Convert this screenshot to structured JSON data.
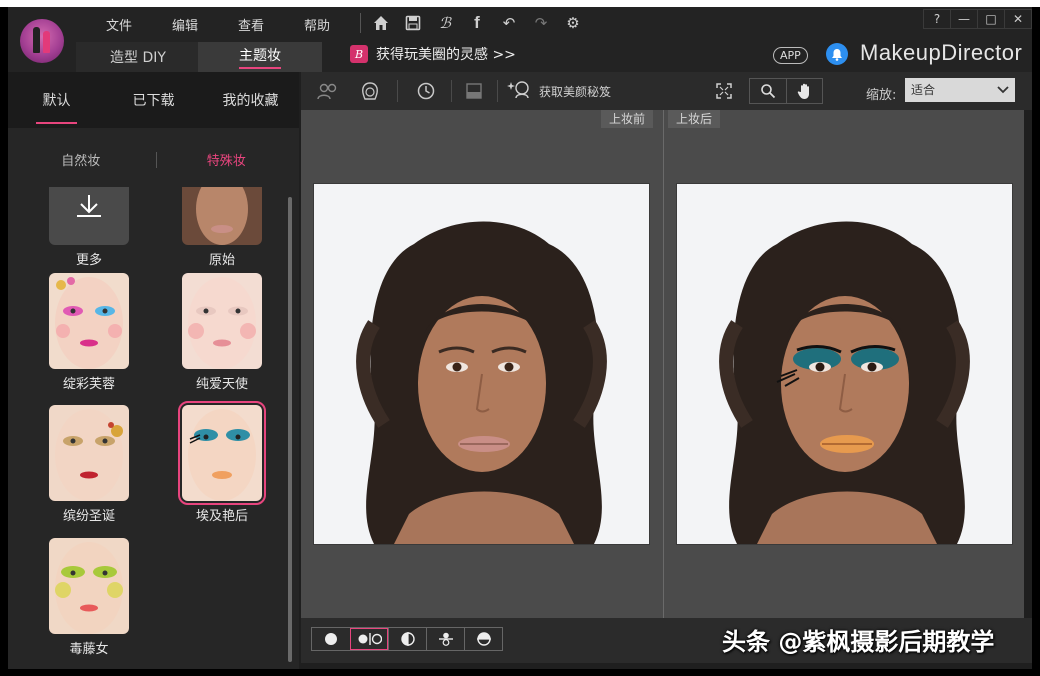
{
  "menu": {
    "items": [
      "文件",
      "编辑",
      "查看",
      "帮助"
    ]
  },
  "toolbar_icons": [
    "home-icon",
    "save-icon",
    "brand-b-icon",
    "facebook-icon",
    "undo-icon",
    "redo-icon",
    "settings-icon"
  ],
  "window_buttons": [
    "?",
    "—",
    "□",
    "✕"
  ],
  "mode_tabs": [
    {
      "label": "造型 DIY",
      "active": false
    },
    {
      "label": "主题妆",
      "active": true
    }
  ],
  "promo": {
    "badge": "B",
    "text": "获得玩美圈的灵感 >>"
  },
  "app_pill": "APP",
  "brand": "MakeupDirector",
  "left": {
    "subtabs": [
      {
        "label": "默认",
        "active": true
      },
      {
        "label": "已下载",
        "active": false
      },
      {
        "label": "我的收藏",
        "active": false
      }
    ],
    "categories": [
      {
        "label": "自然妆",
        "active": false
      },
      {
        "label": "特殊妆",
        "active": true
      }
    ],
    "items": [
      {
        "label": "更多",
        "kind": "more"
      },
      {
        "label": "原始",
        "kind": "face"
      },
      {
        "label": "绽彩芙蓉",
        "kind": "face"
      },
      {
        "label": "纯爱天使",
        "kind": "face"
      },
      {
        "label": "缤纷圣诞",
        "kind": "face"
      },
      {
        "label": "埃及艳后",
        "kind": "face",
        "selected": true
      },
      {
        "label": "毒藤女",
        "kind": "face"
      }
    ]
  },
  "tools": {
    "tips_label": "获取美颜秘笈",
    "zoom_label": "缩放:",
    "zoom_value": "适合"
  },
  "viewport": {
    "before_label": "上妆前",
    "after_label": "上妆后"
  },
  "compare_modes": [
    "single-view-icon",
    "side-by-side-icon",
    "split-vertical-icon",
    "split-horizontal-icon",
    "split-horizontal-alt-icon"
  ],
  "watermark": "头条 @紫枫摄影后期教学",
  "colors": {
    "accent": "#e8457e",
    "bell": "#2d8ff0",
    "panel": "#262626",
    "viewport": "#4b4b4b"
  }
}
